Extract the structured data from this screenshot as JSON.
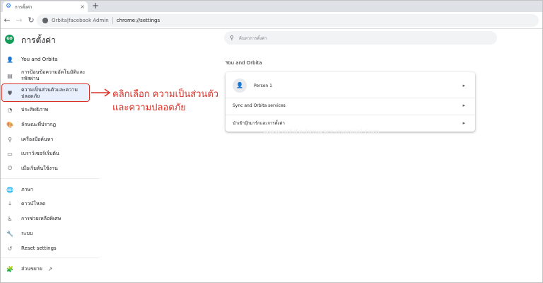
{
  "browser": {
    "tab_title": "การตั้งค่า",
    "tab_close": "×",
    "new_tab": "+",
    "back": "←",
    "forward": "→",
    "reload": "↻",
    "site_name": "Orbita|facebook Admin",
    "url": "chrome://settings"
  },
  "header": {
    "logo_text": "GO",
    "title": "การตั้งค่า",
    "search_placeholder": "ค้นหาการตั้งค่า"
  },
  "sidebar": {
    "items": [
      {
        "label": "You and Orbita",
        "icon": "person-icon"
      },
      {
        "label": "การป้อนข้อความอัตโนมัติและรหัสผ่าน",
        "icon": "clipboard-icon"
      },
      {
        "label": "ความเป็นส่วนตัวและความปลอดภัย",
        "icon": "shield-icon"
      },
      {
        "label": "ประสิทธิภาพ",
        "icon": "speedometer-icon"
      },
      {
        "label": "ลักษณะที่ปรากฏ",
        "icon": "palette-icon"
      },
      {
        "label": "เครื่องมือค้นหา",
        "icon": "search-icon"
      },
      {
        "label": "เบราว์เซอร์เริ่มต้น",
        "icon": "browser-icon"
      },
      {
        "label": "เมื่อเริ่มต้นใช้งาน",
        "icon": "power-icon"
      },
      {
        "label": "ภาษา",
        "icon": "globe-icon"
      },
      {
        "label": "ดาวน์โหลด",
        "icon": "download-icon"
      },
      {
        "label": "การช่วยเหลือพิเศษ",
        "icon": "accessibility-icon"
      },
      {
        "label": "ระบบ",
        "icon": "wrench-icon"
      },
      {
        "label": "Reset settings",
        "icon": "reset-icon"
      },
      {
        "label": "ส่วนขยาย",
        "icon": "puzzle-icon"
      }
    ]
  },
  "annotation": {
    "line1": "คลิกเลือก ความเป็นส่วนตัว",
    "line2": "และความปลอดภัย",
    "color": "#d93025"
  },
  "main": {
    "section_title": "You and Orbita",
    "rows": [
      {
        "label": "Person 1"
      },
      {
        "label": "Sync and Orbita services"
      },
      {
        "label": "นำเข้าบุ๊กมาร์กและการตั้งค่า"
      }
    ],
    "chevron": "▸",
    "watermark": "www.orbita-browser-manual.com"
  }
}
